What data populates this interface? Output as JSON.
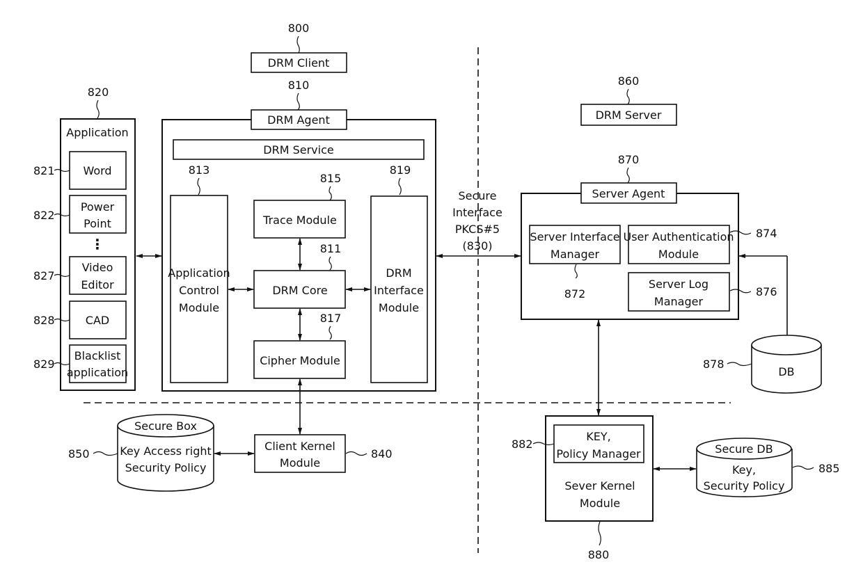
{
  "diagram": {
    "client": {
      "ref": "800",
      "title": "DRM Client",
      "agent": {
        "ref": "810",
        "title": "DRM Agent",
        "service": "DRM Service",
        "app_control": {
          "ref": "813",
          "lines": [
            "Application",
            "Control",
            "Module"
          ]
        },
        "trace": {
          "ref": "815",
          "label": "Trace Module"
        },
        "core": {
          "ref": "811",
          "label": "DRM Core"
        },
        "cipher": {
          "ref": "817",
          "label": "Cipher Module"
        },
        "interface": {
          "ref": "819",
          "lines": [
            "DRM",
            "Interface",
            "Module"
          ]
        }
      },
      "application": {
        "ref": "820",
        "title": "Application",
        "items": [
          {
            "ref": "821",
            "lines": [
              "Word"
            ]
          },
          {
            "ref": "822",
            "lines": [
              "Power",
              "Point"
            ]
          },
          {
            "ref": "827",
            "lines": [
              "Video",
              "Editor"
            ]
          },
          {
            "ref": "828",
            "lines": [
              "CAD"
            ]
          },
          {
            "ref": "829",
            "lines": [
              "Blacklist",
              "application"
            ]
          }
        ],
        "ellipsis": "⋮"
      },
      "kernel": {
        "ref": "840",
        "lines": [
          "Client Kernel",
          "Module"
        ]
      },
      "secure_box": {
        "ref": "850",
        "title": "Secure Box",
        "lines": [
          "Key Access right",
          "Security Policy"
        ]
      }
    },
    "secure_interface": {
      "lines": [
        "Secure",
        "Interface",
        "PKCS#5",
        "(830)"
      ]
    },
    "server": {
      "ref": "860",
      "title": "DRM Server",
      "agent": {
        "ref": "870",
        "title": "Server Agent",
        "interface_manager": {
          "ref": "872",
          "lines": [
            "Server Interface",
            "Manager"
          ]
        },
        "user_auth": {
          "ref": "874",
          "lines": [
            "User Authentication",
            "Module"
          ]
        },
        "log_manager": {
          "ref": "876",
          "lines": [
            "Server Log",
            "Manager"
          ]
        }
      },
      "db": {
        "ref": "878",
        "label": "DB"
      },
      "kernel": {
        "ref": "880",
        "lines": [
          "Sever Kernel",
          "Module"
        ],
        "policy_manager": {
          "ref": "882",
          "lines": [
            "KEY,",
            "Policy Manager"
          ]
        }
      },
      "secure_db": {
        "ref": "885",
        "title": "Secure DB",
        "lines": [
          "Key,",
          "Security Policy"
        ]
      }
    }
  }
}
